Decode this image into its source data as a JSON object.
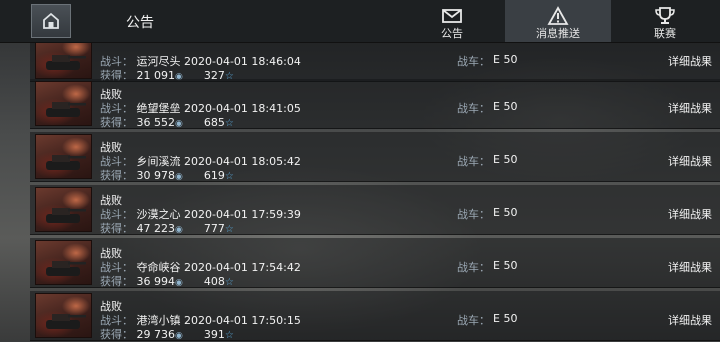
{
  "header": {
    "title": "公告",
    "tabs": [
      {
        "label": "公告",
        "icon": "envelope-icon",
        "active": false
      },
      {
        "label": "消息推送",
        "icon": "warning-icon",
        "active": true
      },
      {
        "label": "联赛",
        "icon": "trophy-icon",
        "active": false
      }
    ]
  },
  "labels": {
    "battle": "战斗：",
    "earned": "获得：",
    "tank": "战车：",
    "detail": "详细战果"
  },
  "rows": [
    {
      "result": "",
      "map": "运河尽头",
      "time": "2020-04-01 18:46:04",
      "credits": "21 091",
      "xp": "327",
      "tank": "E 50"
    },
    {
      "result": "战败",
      "map": "绝望堡垒",
      "time": "2020-04-01 18:41:05",
      "credits": "36 552",
      "xp": "685",
      "tank": "E 50"
    },
    {
      "result": "战败",
      "map": "乡间溪流",
      "time": "2020-04-01 18:05:42",
      "credits": "30 978",
      "xp": "619",
      "tank": "E 50"
    },
    {
      "result": "战败",
      "map": "沙漠之心",
      "time": "2020-04-01 17:59:39",
      "credits": "47 223",
      "xp": "777",
      "tank": "E 50"
    },
    {
      "result": "战败",
      "map": "夺命峡谷",
      "time": "2020-04-01 17:54:42",
      "credits": "36 994",
      "xp": "408",
      "tank": "E 50"
    },
    {
      "result": "战败",
      "map": "港湾小镇",
      "time": "2020-04-01 17:50:15",
      "credits": "29 736",
      "xp": "391",
      "tank": "E 50"
    }
  ]
}
